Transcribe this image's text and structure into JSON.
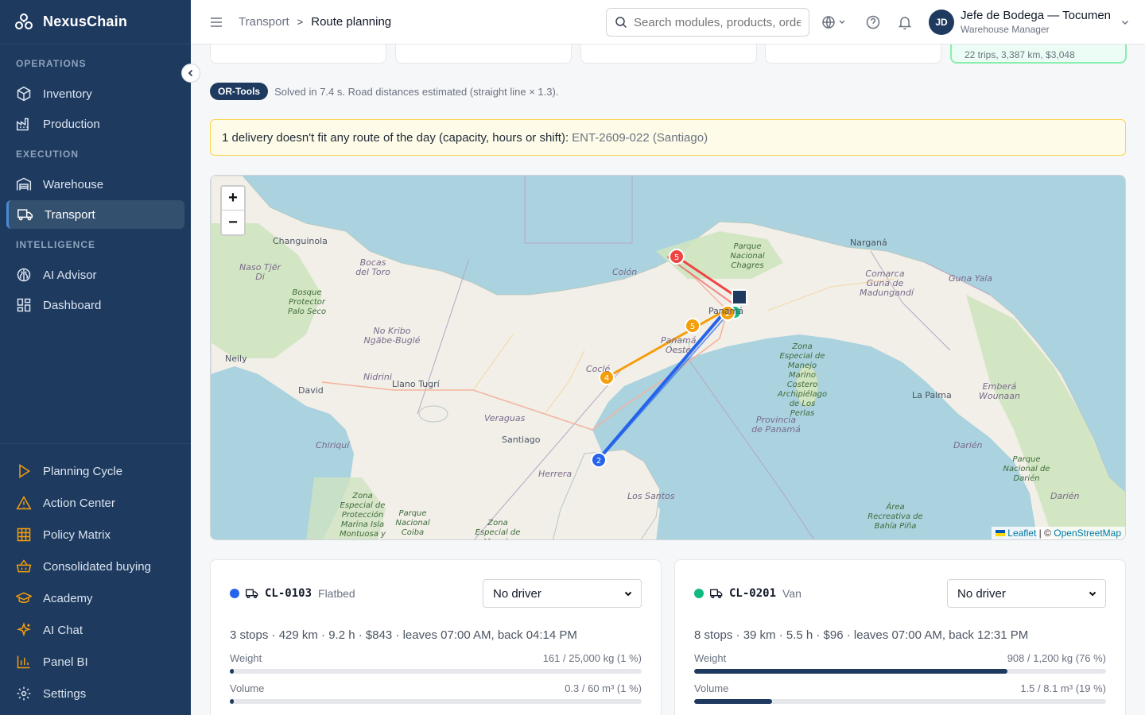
{
  "brand": {
    "name": "NexusChain"
  },
  "sidebar": {
    "sections": [
      {
        "title": "OPERATIONS",
        "items": [
          {
            "label": "Inventory",
            "icon": "box-icon"
          },
          {
            "label": "Production",
            "icon": "factory-icon"
          }
        ]
      },
      {
        "title": "EXECUTION",
        "items": [
          {
            "label": "Warehouse",
            "icon": "warehouse-icon"
          },
          {
            "label": "Transport",
            "icon": "truck-icon",
            "active": true
          }
        ]
      },
      {
        "title": "INTELLIGENCE",
        "items": [
          {
            "label": "AI Advisor",
            "icon": "brain-icon"
          },
          {
            "label": "Dashboard",
            "icon": "grid-icon"
          }
        ]
      }
    ],
    "bottom_items": [
      {
        "label": "Planning Cycle",
        "icon": "play-icon"
      },
      {
        "label": "Action Center",
        "icon": "alert-triangle-icon"
      },
      {
        "label": "Policy Matrix",
        "icon": "table-icon"
      },
      {
        "label": "Consolidated buying",
        "icon": "basket-icon"
      },
      {
        "label": "Academy",
        "icon": "graduation-cap-icon"
      },
      {
        "label": "AI Chat",
        "icon": "sparkles-icon"
      },
      {
        "label": "Panel BI",
        "icon": "bar-chart-icon"
      },
      {
        "label": "Settings",
        "icon": "gear-icon"
      }
    ]
  },
  "header": {
    "breadcrumb_parent": "Transport",
    "breadcrumb_current": "Route planning",
    "search_placeholder": "Search modules, products, orders...",
    "user_initials": "JD",
    "user_name": "Jefe de Bodega — Tocumen",
    "user_role": "Warehouse Manager"
  },
  "stats": {
    "highlight_text": "22 trips, 3,387 km, $3,048"
  },
  "solver": {
    "badge": "OR-Tools",
    "text": "Solved in 7.4 s. Road distances estimated (straight line × 1.3)."
  },
  "alert": {
    "text": "1 delivery doesn't fit any route of the day (capacity, hours or shift):",
    "ref": "ENT-2609-022 (Santiago)"
  },
  "map": {
    "zoom_in": "+",
    "zoom_out": "−",
    "attribution_leaflet": "Leaflet",
    "attribution_sep": " | © ",
    "attribution_osm": "OpenStreetMap",
    "labels": {
      "changuinola": "Changuinola",
      "naso": "Naso Tjër Di",
      "bocas": "Bocas del Toro",
      "bosque": "Bosque Protector Palo Seco",
      "colon": "Colón",
      "parque_chagres": "Parque Nacional Chagres",
      "nargana": "Narganá",
      "comarca": "Comarca Guna de Madungandí",
      "gunayala": "Guna Yala",
      "ngabe": "No Kribo Ngäbe-Buglé",
      "neily": "Neily",
      "nidrini": "Nidrini",
      "llano": "Llano Tugrí",
      "david": "David",
      "panama_oeste": "Panamá Oeste",
      "panama": "Panamá",
      "cocle": "Coclé",
      "zona_marino": "Zona Especial de Manejo Marino Costero Archipiélago de Los Perlas",
      "provincia": "Provincia de Panamá",
      "la_palma": "La Palma",
      "embera": "Emberá Wounaan",
      "veraguas": "Veraguas",
      "santiago": "Santiago",
      "chiriqui": "Chiriquí",
      "herrera": "Herrera",
      "darien": "Darién",
      "parque_darien": "Parque Nacional de Darién",
      "darien2": "Darién",
      "los_santos": "Los Santos",
      "zona_coiba": "Zona Especial de Protección Marina Isla Montuosa y Banco",
      "parque_coiba": "Parque Nacional Coiba",
      "zona_manejo": "Zona Especial de Manejo",
      "area_piña": "Área Recreativa de Bahía Piña"
    },
    "markers": [
      {
        "n": "5",
        "color": "#ef4444"
      },
      {
        "n": "2",
        "color": "#f59e0b"
      },
      {
        "n": "5",
        "color": "#f59e0b"
      },
      {
        "n": "4",
        "color": "#f59e0b"
      },
      {
        "n": "2",
        "color": "#2563eb"
      }
    ],
    "colors": {
      "route_red": "#ef4444",
      "route_orange": "#f59e0b",
      "route_blue": "#2563eb",
      "depot": "#1e3a5f"
    }
  },
  "routes": [
    {
      "color": "#2563eb",
      "code": "CL-0103",
      "type": "Flatbed",
      "driver": "No driver",
      "summary": "3 stops · 429 km · 9.2 h · $843 · leaves 07:00 AM, back 04:14 PM",
      "weight_label": "Weight",
      "weight_value": "161 / 25,000 kg (1 %)",
      "weight_pct": 1,
      "volume_label": "Volume",
      "volume_value": "0.3 / 60 m³ (1 %)",
      "volume_pct": 1
    },
    {
      "color": "#10b981",
      "code": "CL-0201",
      "type": "Van",
      "driver": "No driver",
      "summary": "8 stops · 39 km · 5.5 h · $96 · leaves 07:00 AM, back 12:31 PM",
      "weight_label": "Weight",
      "weight_value": "908 / 1,200 kg (76 %)",
      "weight_pct": 76,
      "volume_label": "Volume",
      "volume_value": "1.5 / 8.1 m³ (19 %)",
      "volume_pct": 19
    }
  ]
}
